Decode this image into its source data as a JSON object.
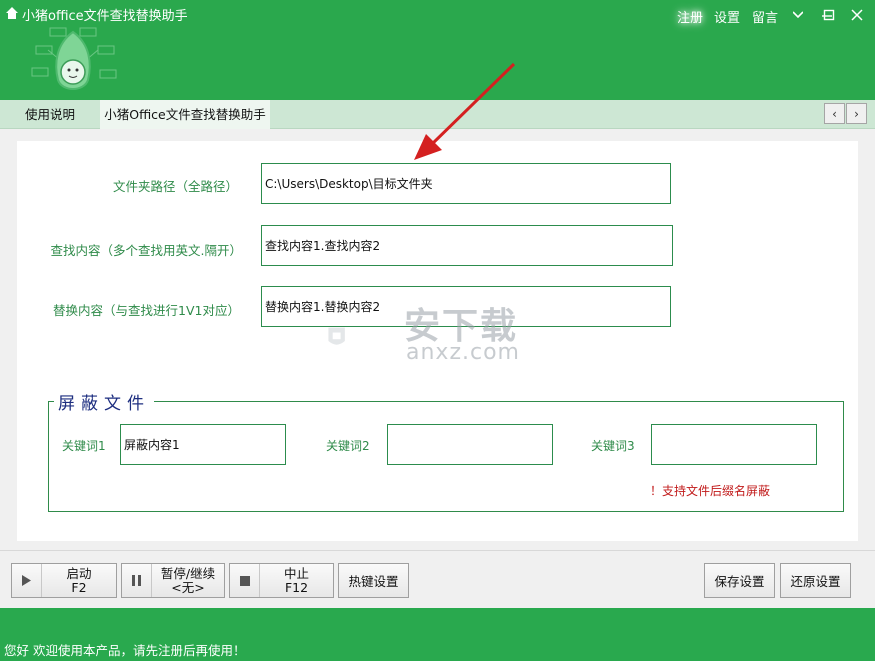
{
  "app": {
    "title": "小猪office文件查找替换助手"
  },
  "header": {
    "register": "注册",
    "settings": "设置",
    "message": "留言"
  },
  "tabs": [
    {
      "label": "使用说明"
    },
    {
      "label": "小猪Office文件查找替换助手"
    }
  ],
  "form": {
    "folder_label": "文件夹路径（全路径）",
    "folder_value": "C:\\Users\\Desktop\\目标文件夹",
    "find_label": "查找内容（多个查找用英文.隔开）",
    "find_value": "查找内容1.查找内容2",
    "replace_label": "替换内容（与查找进行1V1对应）",
    "replace_value": "替换内容1.替换内容2"
  },
  "shield": {
    "title": "屏蔽文件",
    "kw1_label": "关键词1",
    "kw1_value": "屏蔽内容1",
    "kw2_label": "关键词2",
    "kw2_value": "",
    "kw3_label": "关键词3",
    "kw3_value": "",
    "note": "！支持文件后缀名屏蔽"
  },
  "watermark": {
    "text": "安下载",
    "sub": "anxz.com"
  },
  "toolbar": {
    "start_label": "启动",
    "start_key": "F2",
    "pause_label": "暂停/继续",
    "pause_key": "<无>",
    "stop_label": "中止",
    "stop_key": "F12",
    "hotkey_label": "热键设置",
    "save_label": "保存设置",
    "restore_label": "还原设置"
  },
  "status": {
    "text": "您好 欢迎使用本产品，请先注册后再使用！"
  },
  "colors": {
    "brand_green": "#29a94e",
    "field_border": "#2c8c4d",
    "group_title": "#1e2f80",
    "note_red": "#c11a1a",
    "arrow_red": "#d42020"
  }
}
